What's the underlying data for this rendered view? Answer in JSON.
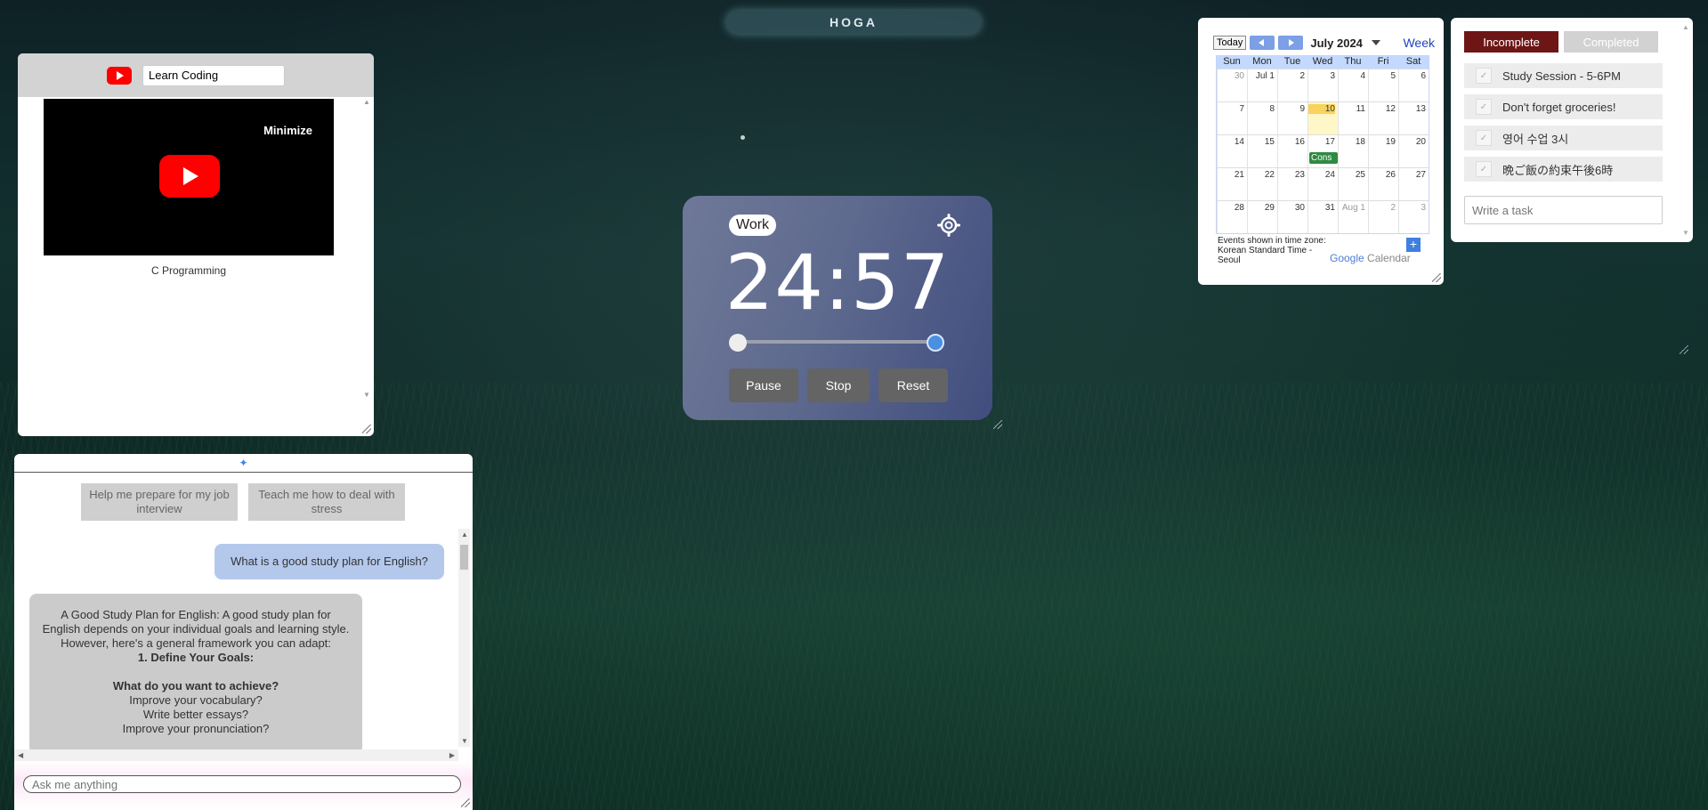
{
  "brand": {
    "name": "HOGA"
  },
  "youtube": {
    "search_value": "Learn Coding",
    "minimize_label": "Minimize",
    "caption": "C Programming"
  },
  "timer": {
    "mode": "Work",
    "time": "24:57",
    "buttons": {
      "pause": "Pause",
      "stop": "Stop",
      "reset": "Reset"
    }
  },
  "calendar": {
    "today_label": "Today",
    "month": "July 2024",
    "view": "Week",
    "dow": [
      "Sun",
      "Mon",
      "Tue",
      "Wed",
      "Thu",
      "Fri",
      "Sat"
    ],
    "weeks": [
      [
        "30",
        "Jul 1",
        "2",
        "3",
        "4",
        "5",
        "6"
      ],
      [
        "7",
        "8",
        "9",
        "10",
        "11",
        "12",
        "13"
      ],
      [
        "14",
        "15",
        "16",
        "17",
        "18",
        "19",
        "20"
      ],
      [
        "21",
        "22",
        "23",
        "24",
        "25",
        "26",
        "27"
      ],
      [
        "28",
        "29",
        "30",
        "31",
        "Aug 1",
        "2",
        "3"
      ]
    ],
    "event_label": "Cons",
    "footer": "Events shown in time zone: Korean Standard Time - Seoul",
    "google": "Google",
    "calendar_word": "Calendar",
    "add": "+"
  },
  "todo": {
    "tab_incomplete": "Incomplete",
    "tab_completed": "Completed",
    "items": [
      "Study Session - 5-6PM",
      "Don't forget groceries!",
      "영어 수업 3시",
      "晩ご飯の約束午後6時"
    ],
    "input_placeholder": "Write a task"
  },
  "chat": {
    "suggestions": [
      "Help me prepare for my job interview",
      "Teach me how to deal with stress"
    ],
    "user_message": "What is a good study plan for English?",
    "bot_lines": [
      "A Good Study Plan for English: A good study plan for English depends on your individual goals and learning style. However, here's a general framework you can adapt:",
      "1. Define Your Goals:",
      "What do you want to achieve?",
      "Improve your vocabulary?",
      "Write better essays?",
      "Improve your pronunciation?"
    ],
    "input_placeholder": "Ask me anything"
  },
  "colors": {
    "todo_active": "#6e1616",
    "timer_slider_end": "#4a8fe0",
    "calendar_today": "#f9d35c",
    "calendar_event": "#2f8a41",
    "youtube_red": "#ff0000"
  }
}
